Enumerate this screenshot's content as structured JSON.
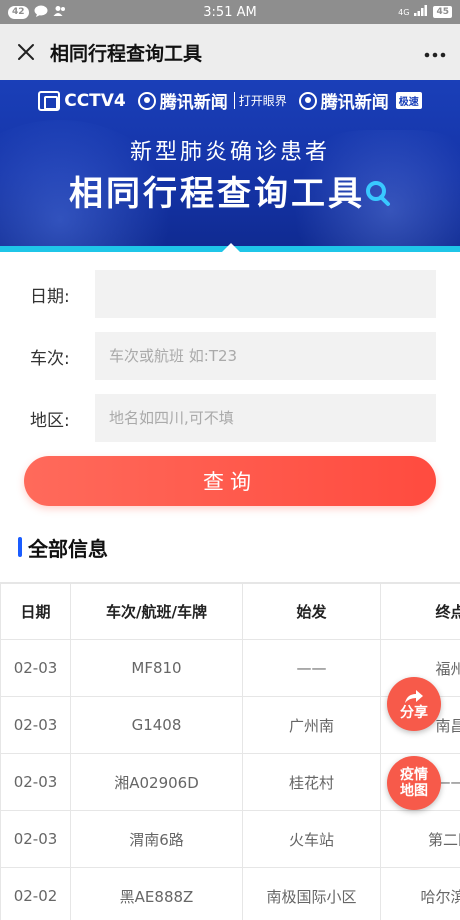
{
  "status_bar": {
    "notification_count": "42",
    "time": "3:51 AM",
    "signal": "4G",
    "battery": "45"
  },
  "title_bar": {
    "title": "相同行程查询工具"
  },
  "banner": {
    "logos": {
      "cctv": "CCTV4",
      "tencent_news": "腾讯新闻",
      "tencent_tagline": "打开眼界",
      "tencent_news_2": "腾讯新闻",
      "speed_tag": "极速"
    },
    "subtitle": "新型肺炎确诊患者",
    "headline": "相同行程查询工具"
  },
  "form": {
    "date": {
      "label": "日期:",
      "value": "",
      "placeholder": ""
    },
    "train": {
      "label": "车次:",
      "value": "",
      "placeholder": "车次或航班 如:T23"
    },
    "region": {
      "label": "地区:",
      "value": "",
      "placeholder": "地名如四川,可不填"
    },
    "search_label": "查询"
  },
  "section": {
    "title": "全部信息"
  },
  "table": {
    "headers": [
      "日期",
      "车次/航班/车牌",
      "始发",
      "终点"
    ],
    "rows": [
      [
        "02-03",
        "MF810",
        "——",
        "福州"
      ],
      [
        "02-03",
        "G1408",
        "广州南",
        "南昌"
      ],
      [
        "02-03",
        "湘A02906D",
        "桂花村",
        "——"
      ],
      [
        "02-03",
        "渭南6路",
        "火车站",
        "第二医"
      ],
      [
        "02-02",
        "黑AE888Z",
        "南极国际小区",
        "哈尔滨传"
      ]
    ]
  },
  "floating": {
    "share": "分享",
    "map_line1": "疫情",
    "map_line2": "地图"
  },
  "colors": {
    "accent_red": "#f75a4a",
    "banner_blue": "#1a3fb8",
    "section_blue": "#1a5cff"
  }
}
